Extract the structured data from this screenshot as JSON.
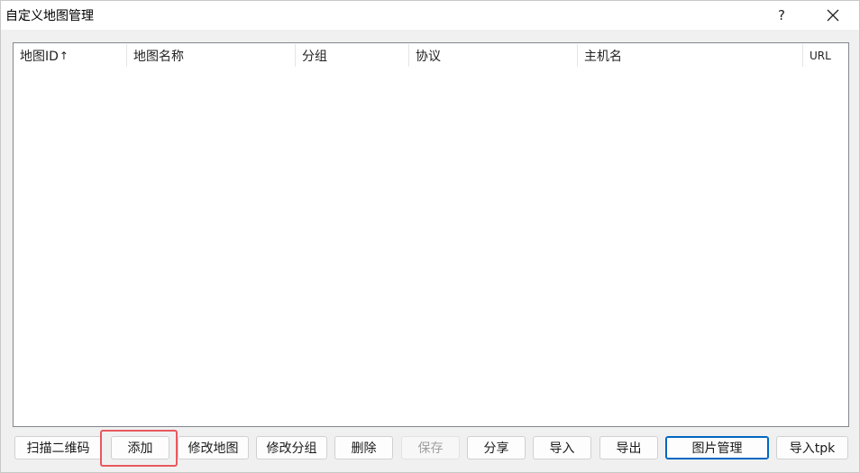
{
  "window": {
    "title": "自定义地图管理",
    "help_label": "?"
  },
  "list": {
    "columns": [
      {
        "label": "地图ID",
        "sort_indicator": "↑"
      },
      {
        "label": "地图名称"
      },
      {
        "label": "分组"
      },
      {
        "label": "协议"
      },
      {
        "label": "主机名"
      },
      {
        "label": "URL"
      }
    ],
    "rows": []
  },
  "buttons": {
    "scan_qr": "扫描二维码",
    "add": "添加",
    "edit_map": "修改地图",
    "edit_group": "修改分组",
    "delete": "删除",
    "save": "保存",
    "share": "分享",
    "import": "导入",
    "export": "导出",
    "image_manage": "图片管理",
    "import_tpk": "导入tpk"
  },
  "colors": {
    "highlight": "#e8595d",
    "default_button_border": "#0067c0"
  }
}
